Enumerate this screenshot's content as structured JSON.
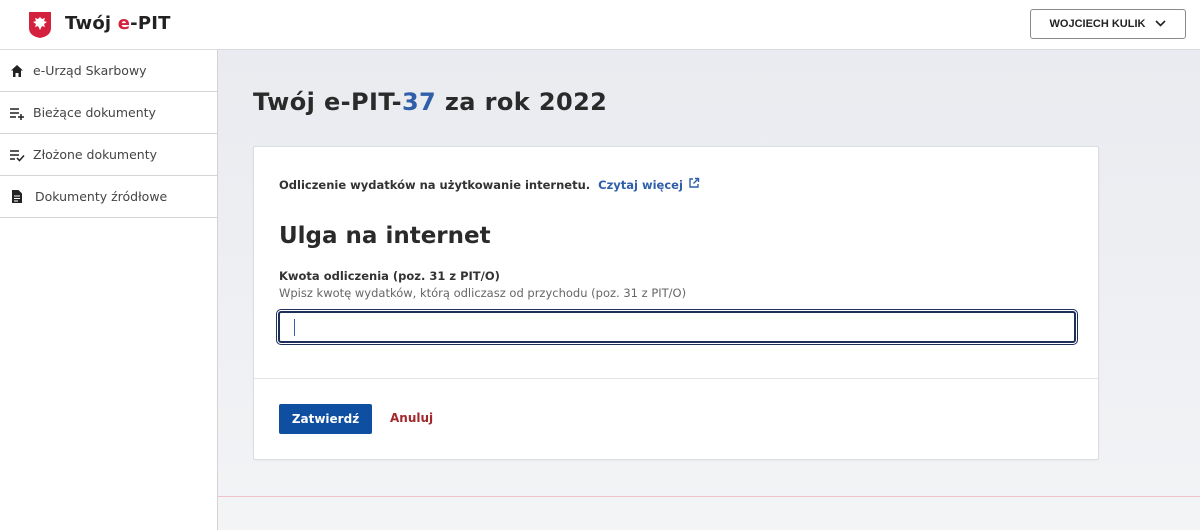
{
  "header": {
    "title_prefix": "Twój ",
    "title_highlight": "e",
    "title_suffix": "-PIT",
    "user_label": "WOJCIECH KULIK",
    "icons": {
      "logo": "polish-eagle-icon",
      "dropdown": "chevron-down-icon"
    }
  },
  "sidebar": {
    "items": [
      {
        "label": "e-Urząd Skarbowy",
        "icon": "home-icon"
      },
      {
        "label": "Bieżące dokumenty",
        "icon": "list-add-icon"
      },
      {
        "label": "Złożone dokumenty",
        "icon": "list-check-icon"
      },
      {
        "label": "Dokumenty źródłowe",
        "icon": "document-icon"
      }
    ]
  },
  "main": {
    "title_part1": "Twój e-PIT-",
    "title_number": "37",
    "title_part2": " za rok 2022",
    "card": {
      "info_text": "Odliczenie wydatków na użytkowanie internetu.",
      "read_more": "Czytaj więcej",
      "read_more_icon": "external-link-icon",
      "section_title": "Ulga na internet",
      "field_label": "Kwota odliczenia (poz. 31 z PIT/O)",
      "field_hint": "Wpisz kwotę wydatków, którą odliczasz od przychodu (poz. 31 z PIT/O)",
      "field_value": "",
      "confirm_label": "Zatwierdź",
      "cancel_label": "Anuluj"
    }
  },
  "colors": {
    "brand_red": "#d4213d",
    "link_blue": "#2f5fa8",
    "primary_button": "#0e4fa1",
    "cancel_red": "#a3282c"
  }
}
